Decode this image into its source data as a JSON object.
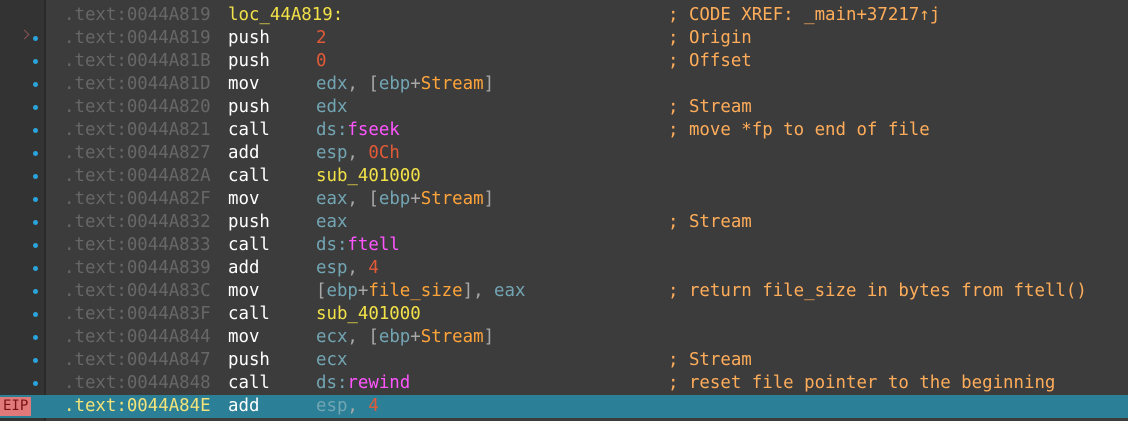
{
  "colors": {
    "background": "#3c3c3c",
    "gutter": "#333333",
    "current_line": "#2b7f96",
    "address": "#676767",
    "mnemonic": "#ffffff",
    "register": "#73a6b4",
    "number": "#e25a38",
    "variable": "#ffa43a",
    "function": "#f2e148",
    "import": "#ff55ff",
    "comment": "#ffad5a",
    "breakpoint_dot": "#2aa4dc",
    "eip_badge": "#e07a7a"
  },
  "eip_marker": "EIP",
  "lines": [
    {
      "addr": ".text:0044A819",
      "label": "loc_44A819:",
      "mnem": "",
      "ops": [],
      "comment": "; CODE XREF: _main+37217↑j",
      "marker": "none",
      "current": false
    },
    {
      "addr": ".text:0044A819",
      "label": "",
      "mnem": "push",
      "ops": [
        {
          "t": "num",
          "v": "2"
        }
      ],
      "comment": "; Origin",
      "marker": "arrow-dot",
      "current": false
    },
    {
      "addr": ".text:0044A81B",
      "label": "",
      "mnem": "push",
      "ops": [
        {
          "t": "num",
          "v": "0"
        }
      ],
      "comment": "; Offset",
      "marker": "dot",
      "current": false
    },
    {
      "addr": ".text:0044A81D",
      "label": "",
      "mnem": "mov",
      "ops": [
        {
          "t": "reg",
          "v": "edx"
        },
        {
          "t": "plain",
          "v": ", ["
        },
        {
          "t": "reg",
          "v": "ebp"
        },
        {
          "t": "plain",
          "v": "+"
        },
        {
          "t": "var",
          "v": "Stream"
        },
        {
          "t": "plain",
          "v": "]"
        }
      ],
      "comment": "",
      "marker": "dot",
      "current": false
    },
    {
      "addr": ".text:0044A820",
      "label": "",
      "mnem": "push",
      "ops": [
        {
          "t": "reg",
          "v": "edx"
        }
      ],
      "comment": "; Stream",
      "marker": "dot",
      "current": false
    },
    {
      "addr": ".text:0044A821",
      "label": "",
      "mnem": "call",
      "ops": [
        {
          "t": "seg",
          "v": "ds:"
        },
        {
          "t": "imp",
          "v": "fseek"
        }
      ],
      "comment": "; move *fp to end of file",
      "marker": "dot",
      "current": false
    },
    {
      "addr": ".text:0044A827",
      "label": "",
      "mnem": "add",
      "ops": [
        {
          "t": "reg",
          "v": "esp"
        },
        {
          "t": "plain",
          "v": ", "
        },
        {
          "t": "num",
          "v": "0Ch"
        }
      ],
      "comment": "",
      "marker": "dot",
      "current": false
    },
    {
      "addr": ".text:0044A82A",
      "label": "",
      "mnem": "call",
      "ops": [
        {
          "t": "fn",
          "v": "sub_401000"
        }
      ],
      "comment": "",
      "marker": "dot",
      "current": false
    },
    {
      "addr": ".text:0044A82F",
      "label": "",
      "mnem": "mov",
      "ops": [
        {
          "t": "reg",
          "v": "eax"
        },
        {
          "t": "plain",
          "v": ", ["
        },
        {
          "t": "reg",
          "v": "ebp"
        },
        {
          "t": "plain",
          "v": "+"
        },
        {
          "t": "var",
          "v": "Stream"
        },
        {
          "t": "plain",
          "v": "]"
        }
      ],
      "comment": "",
      "marker": "dot",
      "current": false
    },
    {
      "addr": ".text:0044A832",
      "label": "",
      "mnem": "push",
      "ops": [
        {
          "t": "reg",
          "v": "eax"
        }
      ],
      "comment": "; Stream",
      "marker": "dot",
      "current": false
    },
    {
      "addr": ".text:0044A833",
      "label": "",
      "mnem": "call",
      "ops": [
        {
          "t": "seg",
          "v": "ds:"
        },
        {
          "t": "imp",
          "v": "ftell"
        }
      ],
      "comment": "",
      "marker": "dot",
      "current": false
    },
    {
      "addr": ".text:0044A839",
      "label": "",
      "mnem": "add",
      "ops": [
        {
          "t": "reg",
          "v": "esp"
        },
        {
          "t": "plain",
          "v": ", "
        },
        {
          "t": "num",
          "v": "4"
        }
      ],
      "comment": "",
      "marker": "dot",
      "current": false
    },
    {
      "addr": ".text:0044A83C",
      "label": "",
      "mnem": "mov",
      "ops": [
        {
          "t": "plain",
          "v": "["
        },
        {
          "t": "reg",
          "v": "ebp"
        },
        {
          "t": "plain",
          "v": "+"
        },
        {
          "t": "var",
          "v": "file_size"
        },
        {
          "t": "plain",
          "v": "], "
        },
        {
          "t": "reg",
          "v": "eax"
        }
      ],
      "comment": "; return file_size in bytes from ftell()",
      "marker": "dot",
      "current": false
    },
    {
      "addr": ".text:0044A83F",
      "label": "",
      "mnem": "call",
      "ops": [
        {
          "t": "fn",
          "v": "sub_401000"
        }
      ],
      "comment": "",
      "marker": "dot",
      "current": false
    },
    {
      "addr": ".text:0044A844",
      "label": "",
      "mnem": "mov",
      "ops": [
        {
          "t": "reg",
          "v": "ecx"
        },
        {
          "t": "plain",
          "v": ", ["
        },
        {
          "t": "reg",
          "v": "ebp"
        },
        {
          "t": "plain",
          "v": "+"
        },
        {
          "t": "var",
          "v": "Stream"
        },
        {
          "t": "plain",
          "v": "]"
        }
      ],
      "comment": "",
      "marker": "dot",
      "current": false
    },
    {
      "addr": ".text:0044A847",
      "label": "",
      "mnem": "push",
      "ops": [
        {
          "t": "reg",
          "v": "ecx"
        }
      ],
      "comment": "; Stream",
      "marker": "dot",
      "current": false
    },
    {
      "addr": ".text:0044A848",
      "label": "",
      "mnem": "call",
      "ops": [
        {
          "t": "seg",
          "v": "ds:"
        },
        {
          "t": "imp",
          "v": "rewind"
        }
      ],
      "comment": "; reset file pointer to the beginning",
      "marker": "dot",
      "current": false
    },
    {
      "addr": ".text:0044A84E",
      "label": "",
      "mnem": "add",
      "ops": [
        {
          "t": "reg",
          "v": "esp"
        },
        {
          "t": "plain",
          "v": ", "
        },
        {
          "t": "num",
          "v": "4"
        }
      ],
      "comment": "",
      "marker": "eip",
      "current": true
    }
  ]
}
